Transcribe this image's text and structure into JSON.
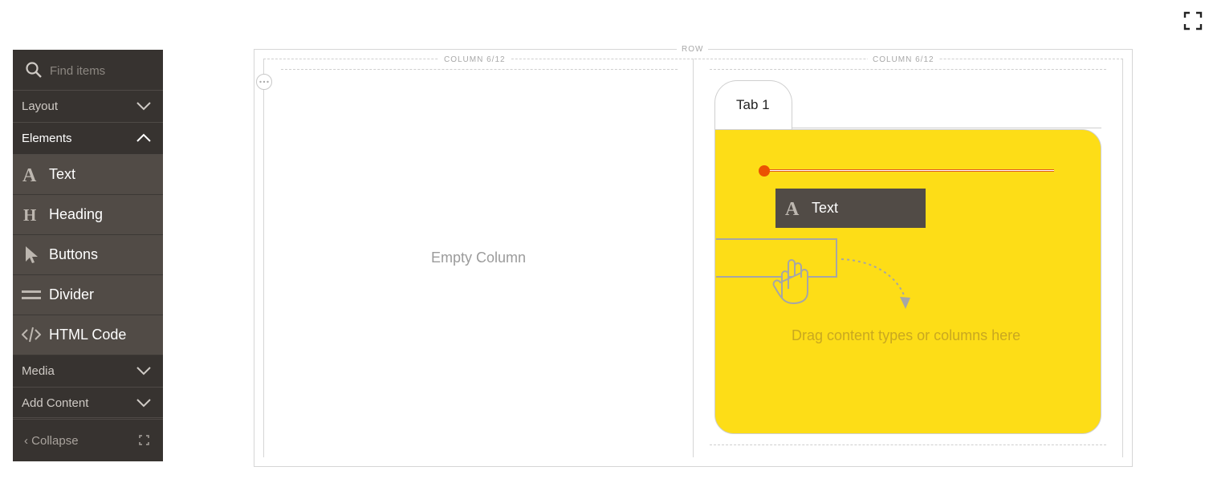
{
  "sidebar": {
    "search": {
      "placeholder": "Find items"
    },
    "sections": {
      "layout": "Layout",
      "elements": "Elements",
      "media": "Media",
      "add_content": "Add Content"
    },
    "items": [
      {
        "label": "Text",
        "icon": "text-icon"
      },
      {
        "label": "Heading",
        "icon": "heading-icon"
      },
      {
        "label": "Buttons",
        "icon": "cursor-icon"
      },
      {
        "label": "Divider",
        "icon": "divider-icon"
      },
      {
        "label": "HTML Code",
        "icon": "code-icon"
      }
    ],
    "collapse_label": "Collapse"
  },
  "stage": {
    "row_label": "ROW",
    "col_left_label": "COLUMN 6/12",
    "col_right_label": "COLUMN 6/12",
    "empty_column": "Empty Column",
    "tab_label": "Tab 1",
    "dragging_label": "Text",
    "drag_hint": "Drag content types or columns here"
  },
  "colors": {
    "sidebar_bg": "#373330",
    "item_bg": "#514b46",
    "tab_panel": "#fddd17",
    "drop_indicator": "#eb5202"
  }
}
